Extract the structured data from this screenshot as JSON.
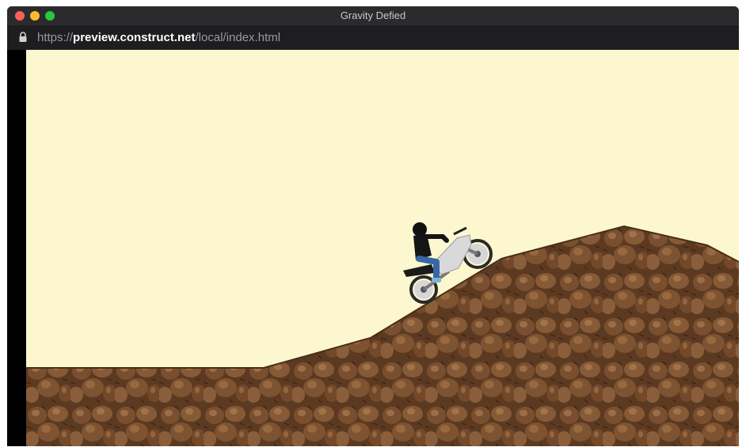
{
  "window": {
    "title": "Gravity Defied",
    "url": {
      "protocol": "https://",
      "host": "preview.construct.net",
      "path": "/local/index.html"
    },
    "traffic_lights": [
      "close",
      "minimize",
      "zoom"
    ]
  },
  "game": {
    "name": "Gravity Defied",
    "sky_color": "#fdf7cf",
    "terrain_color": "#6b4326",
    "bike_color": "#d9d9db",
    "rider_jacket_color": "#151515",
    "rider_pants_color": "#3a66a5"
  }
}
